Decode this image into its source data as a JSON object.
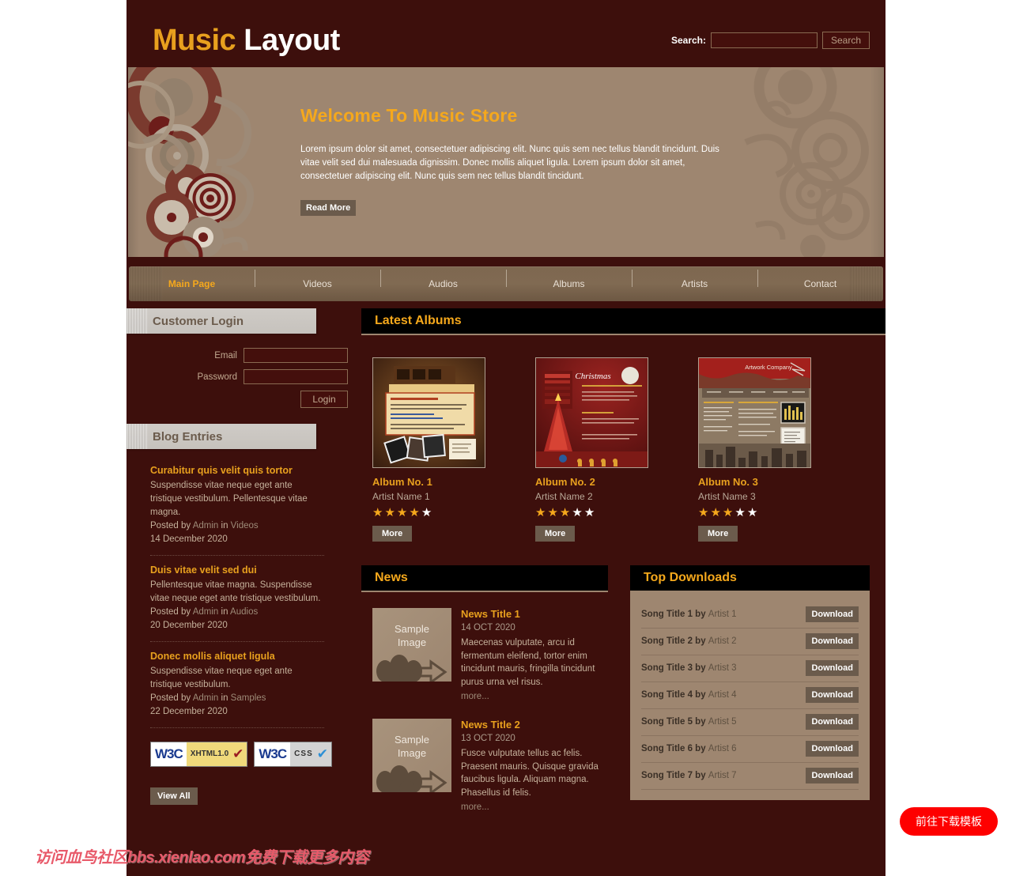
{
  "header": {
    "logo_highlight": "Music",
    "logo_rest": " Layout",
    "search_label": "Search:",
    "search_value": "",
    "search_placeholder": "",
    "search_button": "Search"
  },
  "banner": {
    "title": "Welcome To Music Store",
    "text": "Lorem ipsum dolor sit amet, consectetuer adipiscing elit. Nunc quis sem nec tellus blandit tincidunt. Duis vitae velit sed dui malesuada dignissim. Donec mollis aliquet ligula. Lorem ipsum dolor sit amet, consectetuer adipiscing elit. Nunc quis sem nec tellus blandit tincidunt.",
    "read_more": "Read More"
  },
  "nav": {
    "items": [
      {
        "label": "Main Page",
        "active": true
      },
      {
        "label": "Videos",
        "active": false
      },
      {
        "label": "Audios",
        "active": false
      },
      {
        "label": "Albums",
        "active": false
      },
      {
        "label": "Artists",
        "active": false
      },
      {
        "label": "Contact",
        "active": false
      }
    ]
  },
  "login": {
    "heading": "Customer Login",
    "email_label": "Email",
    "email_value": "",
    "password_label": "Password",
    "password_value": "",
    "submit_label": "Login"
  },
  "blog": {
    "heading": "Blog Entries",
    "entries": [
      {
        "title": "Curabitur quis velit quis tortor",
        "desc": "Suspendisse vitae neque eget ante tristique vestibulum. Pellentesque vitae magna.",
        "posted_prefix": "Posted by ",
        "author": "Admin",
        "in_word": " in ",
        "category": "Videos",
        "date": "14 December 2020"
      },
      {
        "title": "Duis vitae velit sed dui",
        "desc": "Pellentesque vitae magna. Suspendisse vitae neque eget ante tristique vestibulum.",
        "posted_prefix": "Posted by ",
        "author": "Admin",
        "in_word": " in ",
        "category": "Audios",
        "date": "20 December 2020"
      },
      {
        "title": "Donec mollis aliquet ligula",
        "desc": "Suspendisse vitae neque eget ante tristique vestibulum.",
        "posted_prefix": "Posted by ",
        "author": "Admin",
        "in_word": " in ",
        "category": "Samples",
        "date": "22 December 2020"
      }
    ],
    "view_all": "View All"
  },
  "badges": [
    {
      "org": "W3C",
      "kind": "XHTML 1.0",
      "kind_line1": "XHTML",
      "kind_line2": "1.0"
    },
    {
      "org": "W3C",
      "kind": "CSS",
      "kind_line1": "CSS",
      "kind_line2": ""
    }
  ],
  "albums": {
    "heading": "Latest Albums",
    "items": [
      {
        "name": "Album No. 1",
        "artist": "Artist Name 1",
        "rating": 4,
        "max_rating": 5,
        "more_label": "More"
      },
      {
        "name": "Album No. 2",
        "artist": "Artist Name 2",
        "rating": 3,
        "max_rating": 5,
        "more_label": "More"
      },
      {
        "name": "Album No. 3",
        "artist": "Artist Name 3",
        "rating": 3,
        "max_rating": 5,
        "more_label": "More"
      }
    ]
  },
  "news": {
    "heading": "News",
    "thumb_caption_line1": "Sample",
    "thumb_caption_line2": "Image",
    "items": [
      {
        "title": "News Title 1",
        "date": "14 OCT 2020",
        "desc": "Maecenas vulputate, arcu id fermentum eleifend, tortor enim tincidunt mauris, fringilla tincidunt purus urna vel risus.",
        "more": "more..."
      },
      {
        "title": "News Title 2",
        "date": "13 OCT 2020",
        "desc": "Fusce vulputate tellus ac felis. Praesent mauris. Quisque gravida faucibus ligula. Aliquam magna. Phasellus id felis.",
        "more": "more..."
      }
    ]
  },
  "downloads": {
    "heading": "Top Downloads",
    "button_label": "Download",
    "items": [
      {
        "song": "Song Title 1",
        "by": " by ",
        "artist": "Artist 1"
      },
      {
        "song": "Song Title 2",
        "by": " by ",
        "artist": "Artist 2"
      },
      {
        "song": "Song Title 3",
        "by": " by ",
        "artist": "Artist 3"
      },
      {
        "song": "Song Title 4",
        "by": " by ",
        "artist": "Artist 4"
      },
      {
        "song": "Song Title 5",
        "by": " by ",
        "artist": "Artist 5"
      },
      {
        "song": "Song Title 6",
        "by": " by ",
        "artist": "Artist 6"
      },
      {
        "song": "Song Title 7",
        "by": " by ",
        "artist": "Artist 7"
      }
    ]
  },
  "watermark": {
    "text": "访问血鸟社区bbs.xienlao.com免费下载更多内容"
  },
  "floating_cta": {
    "label": "前往下载模板"
  },
  "colors": {
    "page_dark": "#3d0f0c",
    "accent_gold": "#e8a01e",
    "banner_gold": "#f5a81c",
    "tan": "#9e8670",
    "panel_grey": "#c9c5c0",
    "button_brown": "#6b5b4c",
    "cta_red": "#fe0000",
    "watermark_pink": "#e85a6a"
  }
}
